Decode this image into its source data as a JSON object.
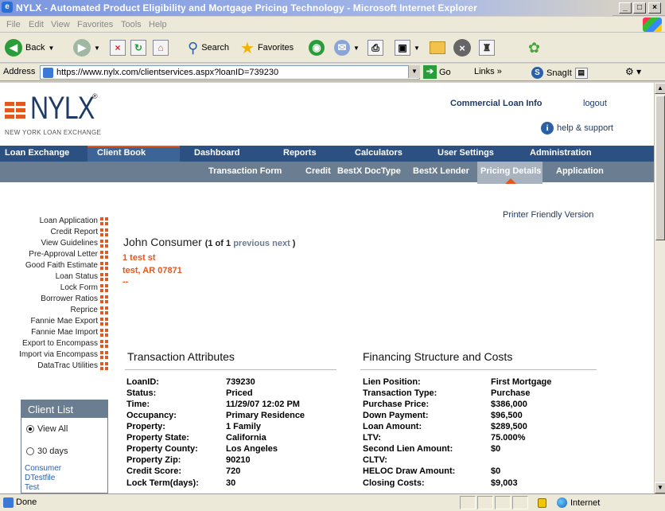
{
  "window": {
    "title": "NYLX - Automated Product Eligibility and Mortgage Pricing Technology - Microsoft Internet Explorer",
    "controls": [
      "_",
      "□",
      "×"
    ]
  },
  "menubar": [
    "File",
    "Edit",
    "View",
    "Favorites",
    "Tools",
    "Help"
  ],
  "toolbar": {
    "back": "Back",
    "search": "Search",
    "favorites": "Favorites"
  },
  "address": {
    "label": "Address",
    "url": "https://www.nylx.com/clientservices.aspx?loanID=739230",
    "go": "Go",
    "links": "Links",
    "snagit": "SnagIt"
  },
  "logo": {
    "word": "NYLX",
    "reg": "®",
    "sub": "NEW YORK LOAN EXCHANGE"
  },
  "header": {
    "commercial": "Commercial Loan Info",
    "logout": "logout",
    "help": "help & support"
  },
  "nav": [
    "Loan Exchange",
    "Client Book",
    "Dashboard",
    "Reports",
    "Calculators",
    "User Settings",
    "Administration"
  ],
  "subnav": [
    "Transaction Form",
    "Credit",
    "BestX DocType",
    "BestX Lender",
    "Pricing Details",
    "Application"
  ],
  "printer": "Printer Friendly Version",
  "sidemenu": [
    "Loan Application",
    "Credit Report",
    "View Guidelines",
    "Pre-Approval Letter",
    "Good Faith Estimate",
    "Loan Status",
    "Lock Form",
    "Borrower Ratios",
    "Reprice",
    "Fannie Mae Export",
    "Fannie Mae Import",
    "Export to Encompass",
    "Import via Encompass",
    "DataTrac Utilities"
  ],
  "consumer": {
    "name": "John Consumer",
    "of": "(1 of 1",
    "previous": "previous",
    "next": "next",
    "close": ")",
    "street": "1 test st",
    "citystate": "test, AR 07871",
    "extra": "--"
  },
  "transaction": {
    "title": "Transaction Attributes",
    "rows": [
      {
        "k": "LoanID:",
        "v": "739230"
      },
      {
        "k": "Status:",
        "v": "Priced"
      },
      {
        "k": "Time:",
        "v": "11/29/07 12:02 PM"
      },
      {
        "k": "Occupancy:",
        "v": "Primary Residence"
      },
      {
        "k": "Property:",
        "v": "1 Family"
      },
      {
        "k": "Property State:",
        "v": "California"
      },
      {
        "k": "Property County:",
        "v": "Los Angeles"
      },
      {
        "k": "Property Zip:",
        "v": "90210"
      },
      {
        "k": "Credit Score:",
        "v": "720"
      },
      {
        "k": "Lock Term(days):",
        "v": "30"
      }
    ]
  },
  "financing": {
    "title": "Financing Structure and Costs",
    "rows": [
      {
        "k": "Lien Position:",
        "v": "First Mortgage"
      },
      {
        "k": "Transaction Type:",
        "v": "Purchase"
      },
      {
        "k": "Purchase Price:",
        "v": "$386,000"
      },
      {
        "k": "Down Payment:",
        "v": "$96,500"
      },
      {
        "k": "Loan Amount:",
        "v": "$289,500"
      },
      {
        "k": "LTV:",
        "v": "75.000%"
      },
      {
        "k": "Second Lien Amount:",
        "v": "$0"
      },
      {
        "k": "CLTV:",
        "v": ""
      },
      {
        "k": "HELOC Draw Amount:",
        "v": "$0"
      },
      {
        "k": "Closing Costs:",
        "v": "$9,003"
      }
    ]
  },
  "clientlist": {
    "title": "Client List",
    "viewall": "View All",
    "days30": "30 days",
    "clients": [
      "Consumer",
      "DTestfile",
      "Test"
    ]
  },
  "status": {
    "done": "Done",
    "zone": "Internet"
  }
}
